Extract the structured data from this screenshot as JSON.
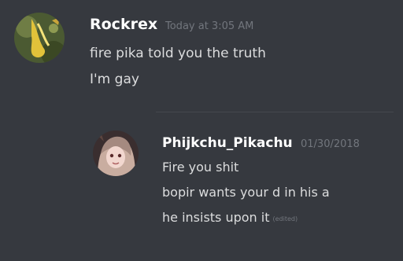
{
  "messages": [
    {
      "username": "Rockrex",
      "timestamp": "Today at 3:05 AM",
      "avatar_icon": "rockrex-avatar-icon",
      "lines": [
        "fire pika told you the truth",
        "I'm gay"
      ]
    },
    {
      "username": "Phijkchu_Pikachu",
      "timestamp": "01/30/2018",
      "avatar_icon": "phijkchu-avatar-icon",
      "lines": [
        "Fire you shit",
        "bopir wants your d in his a",
        "he insists upon it"
      ],
      "edited_label": "(edited)"
    }
  ],
  "colors": {
    "background": "#36393f",
    "username": "#ffffff",
    "message_text": "#dcddde",
    "timestamp": "#72767d",
    "divider": "#44474d"
  }
}
